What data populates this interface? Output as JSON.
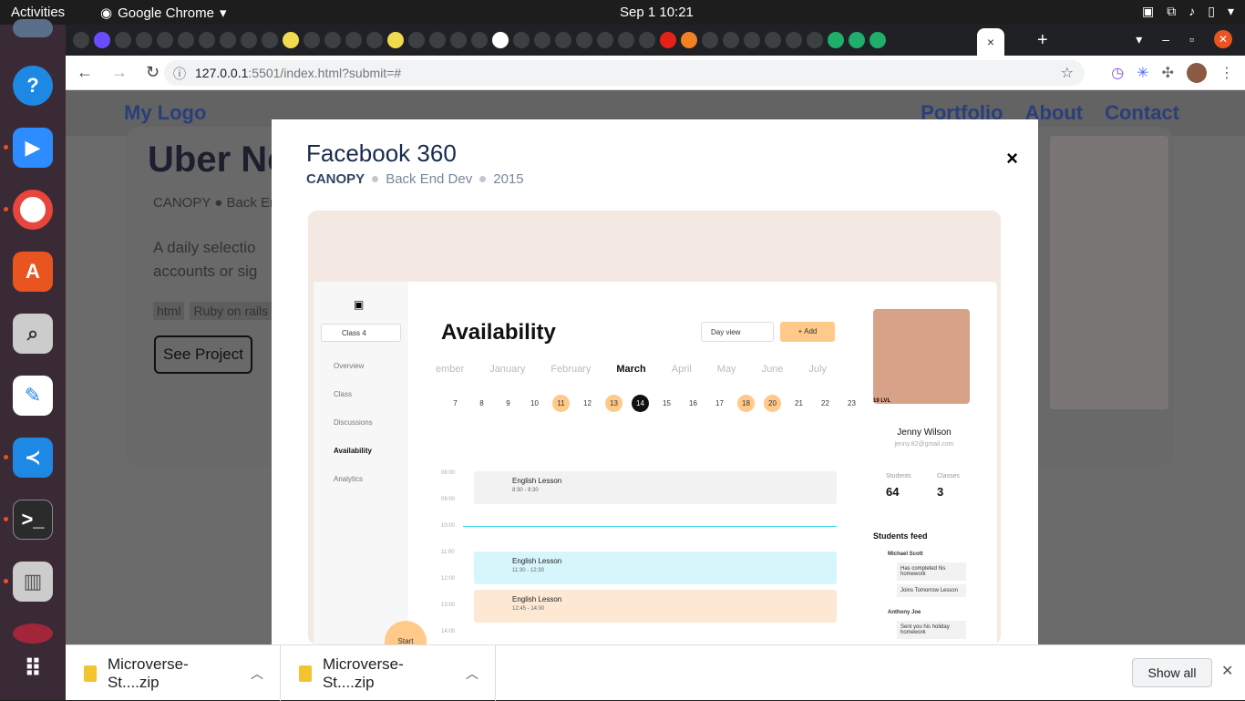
{
  "system": {
    "activities": "Activities",
    "app_name": "Google Chrome",
    "clock": "Sep 1  10:21"
  },
  "browser": {
    "url_host": "127.0.0.1",
    "url_rest": ":5501/index.html?submit=#",
    "tab_close": "×",
    "new_tab": "+"
  },
  "page": {
    "logo": "My Logo",
    "menu": [
      "Portfolio",
      "About",
      "Contact"
    ],
    "bg_title": "Uber Ne",
    "bg_meta": "CANOPY  ●  Back En",
    "bg_desc_1": "A daily selectio",
    "bg_desc_2": "accounts or sig",
    "bg_tags": [
      "html",
      "Ruby on rails"
    ],
    "bg_button": "See Project"
  },
  "modal": {
    "title": "Facebook 360",
    "client": "CANOPY",
    "role": "Back End Dev",
    "year": "2015",
    "close": "×"
  },
  "dashboard": {
    "class_select": "Class 4",
    "nav": [
      "Overview",
      "Class",
      "Discussions",
      "Availability",
      "Analytics"
    ],
    "title": "Availability",
    "view": "Day view",
    "add": "+ Add",
    "months": [
      "ember",
      "January",
      "February",
      "March",
      "April",
      "May",
      "June",
      "July"
    ],
    "days": [
      "7",
      "8",
      "9",
      "10",
      "11",
      "12",
      "13",
      "14",
      "15",
      "16",
      "17",
      "18",
      "20",
      "21",
      "22",
      "23"
    ],
    "times": [
      "08:00",
      "09:00",
      "10:00",
      "11:00",
      "12:00",
      "13:00",
      "14:00"
    ],
    "events": [
      {
        "title": "English Lesson",
        "time": "8:30 - 9:30"
      },
      {
        "title": "English Lesson",
        "time": "11:30 - 12:30"
      },
      {
        "title": "English Lesson",
        "time": "12:45 - 14:00"
      }
    ],
    "profile_level": "19 LVL",
    "profile_name": "Jenny Wilson",
    "profile_email": "jenny.82@gmail.com",
    "students_label": "Students",
    "students_value": "64",
    "classes_label": "Classes",
    "classes_value": "3",
    "feed_title": "Students feed",
    "feed": [
      "Michael Scott",
      "Has completed his homework",
      "Joins Tomorrow Lesson",
      "Anthony Joe",
      "Sent you his holiday homework"
    ],
    "start": "Start"
  },
  "downloads": {
    "items": [
      "Microverse-St....zip",
      "Microverse-St....zip"
    ],
    "show_all": "Show all"
  }
}
